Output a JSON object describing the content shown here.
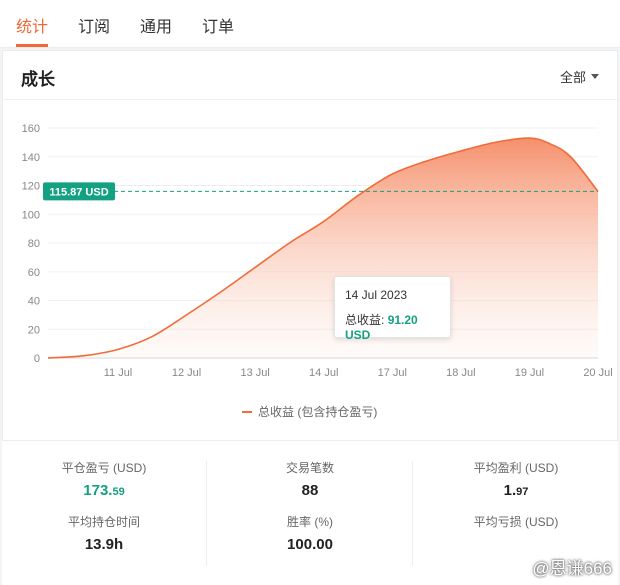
{
  "tabs": [
    {
      "label": "统计",
      "active": true
    },
    {
      "label": "订阅"
    },
    {
      "label": "通用"
    },
    {
      "label": "订单"
    }
  ],
  "panel": {
    "title": "成长",
    "filter_label": "全部"
  },
  "chart_data": {
    "type": "area",
    "y_ticks": [
      "0",
      "20",
      "40",
      "60",
      "80",
      "100",
      "120",
      "140",
      "160"
    ],
    "ylim": [
      0,
      160
    ],
    "x_ticks": [
      "11 Jul",
      "12 Jul",
      "13 Jul",
      "14 Jul",
      "17 Jul",
      "18 Jul",
      "19 Jul",
      "20 Jul"
    ],
    "series": [
      {
        "name": "总收益 (包含持仓盈亏)",
        "x": [
          0,
          0.5,
          1,
          1.5,
          2,
          2.5,
          3,
          3.5,
          4,
          4.5,
          5,
          5.5,
          6,
          6.5,
          7,
          7.3,
          7.6,
          8
        ],
        "values": [
          0,
          1.5,
          6,
          15,
          30,
          46,
          63,
          80,
          95,
          113,
          128,
          137,
          144,
          150,
          153,
          149,
          140,
          115.87
        ]
      }
    ],
    "reference_line": {
      "value": 115.87,
      "label": "115.87 USD"
    },
    "tooltip": {
      "date": "14 Jul 2023",
      "label": "总收益:",
      "value": "91.20 USD"
    },
    "colors": {
      "line": "#f26b3a",
      "fill_top": "#f58a64",
      "reference": "#13a181"
    },
    "grid": "horizontal",
    "legend_position": "bottom"
  },
  "stats": [
    {
      "label": "平仓盈亏 (USD)",
      "value_main": "173.",
      "value_small": "59",
      "green": true
    },
    {
      "label": "交易笔数",
      "value_main": "88",
      "value_small": ""
    },
    {
      "label": "平均盈利 (USD)",
      "value_main": "1.",
      "value_small": "97"
    },
    {
      "label": "平均持仓时间",
      "value_main": "13.9h",
      "value_small": ""
    },
    {
      "label": "胜率 (%)",
      "value_main": "100.00",
      "value_small": ""
    },
    {
      "label": "平均亏损 (USD)",
      "value_main": "",
      "value_small": ""
    }
  ],
  "watermark": "@恩谦666"
}
